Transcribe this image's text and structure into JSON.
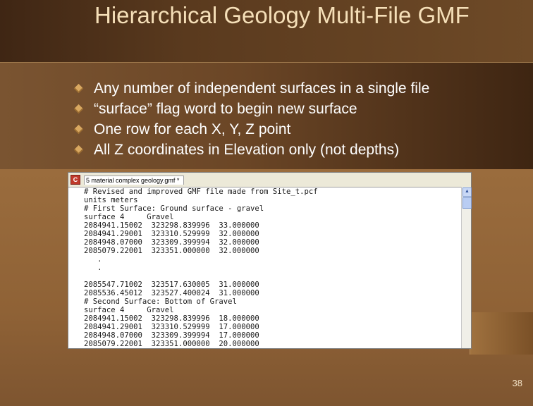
{
  "slide": {
    "title": "Hierarchical Geology Multi-File GMF",
    "bullets": [
      "Any number of independent surfaces in a single file",
      "“surface” flag word to begin new surface",
      "One row for each X, Y, Z point",
      "All Z coordinates in Elevation only (not depths)"
    ],
    "page_number": "38"
  },
  "editor": {
    "tab_label": "5 material complex geology.gmf *",
    "file_icon_letter": "C",
    "lines": [
      "# Revised and improved GMF file made from Site_t.pcf",
      "units meters",
      "# First Surface: Ground surface - gravel",
      "surface 4     Gravel",
      "2084941.15002  323298.839996  33.000000",
      "2084941.29001  323310.529999  32.000000",
      "2084948.07000  323309.399994  32.000000",
      "2085079.22001  323351.000000  32.000000",
      "   .",
      "   .",
      "",
      "2085547.71002  323517.630005  31.000000",
      "2085536.45012  323527.400024  31.000000",
      "# Second Surface: Bottom of Gravel",
      "surface 4     Gravel",
      "2084941.15002  323298.839996  18.000000",
      "2084941.29001  323310.529999  17.000000",
      "2084948.07000  323309.399994  17.000000",
      "2085079.22001  323351.000000  20.000000"
    ]
  },
  "colors": {
    "title": "#f5dfb8",
    "bullet_text": "#ffffff",
    "bullet_icon": "#d9a860"
  }
}
